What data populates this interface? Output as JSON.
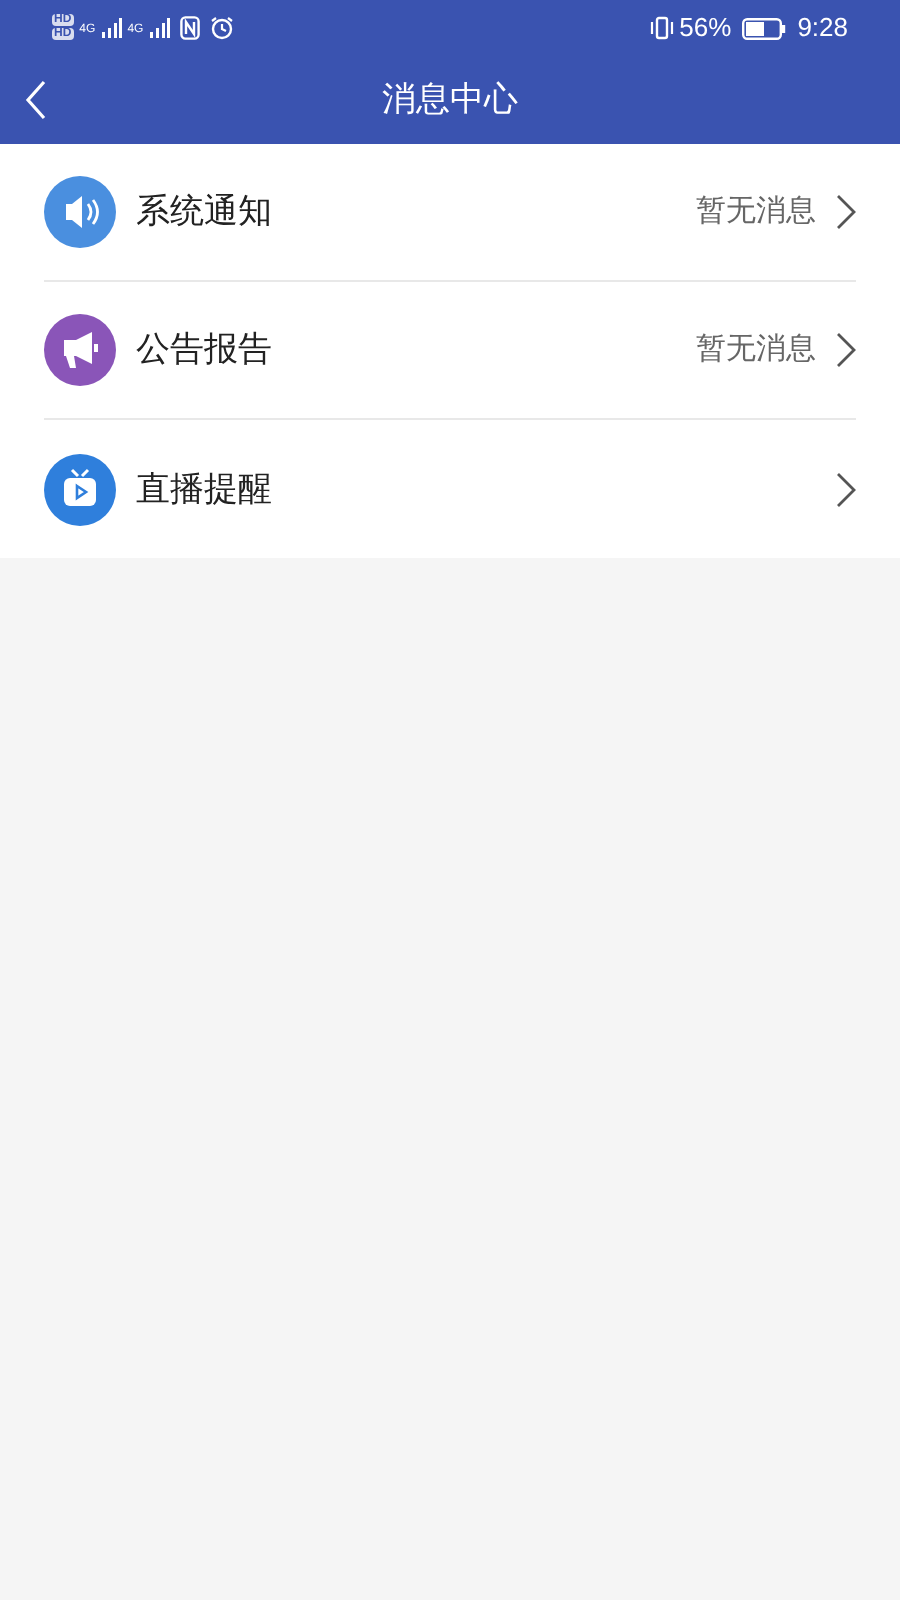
{
  "status_bar": {
    "network_badges": [
      "HD",
      "HD"
    ],
    "signal_labels": [
      "4G",
      "4G"
    ],
    "battery": "56%",
    "time": "9:28"
  },
  "header": {
    "title": "消息中心"
  },
  "items": [
    {
      "kind": "speaker",
      "color": "#4a8fdf",
      "label": "系统通知",
      "status": "暂无消息"
    },
    {
      "kind": "megaphone",
      "color": "#8a55b8",
      "label": "公告报告",
      "status": "暂无消息"
    },
    {
      "kind": "tv",
      "color": "#2f7fdc",
      "label": "直播提醒"
    }
  ]
}
